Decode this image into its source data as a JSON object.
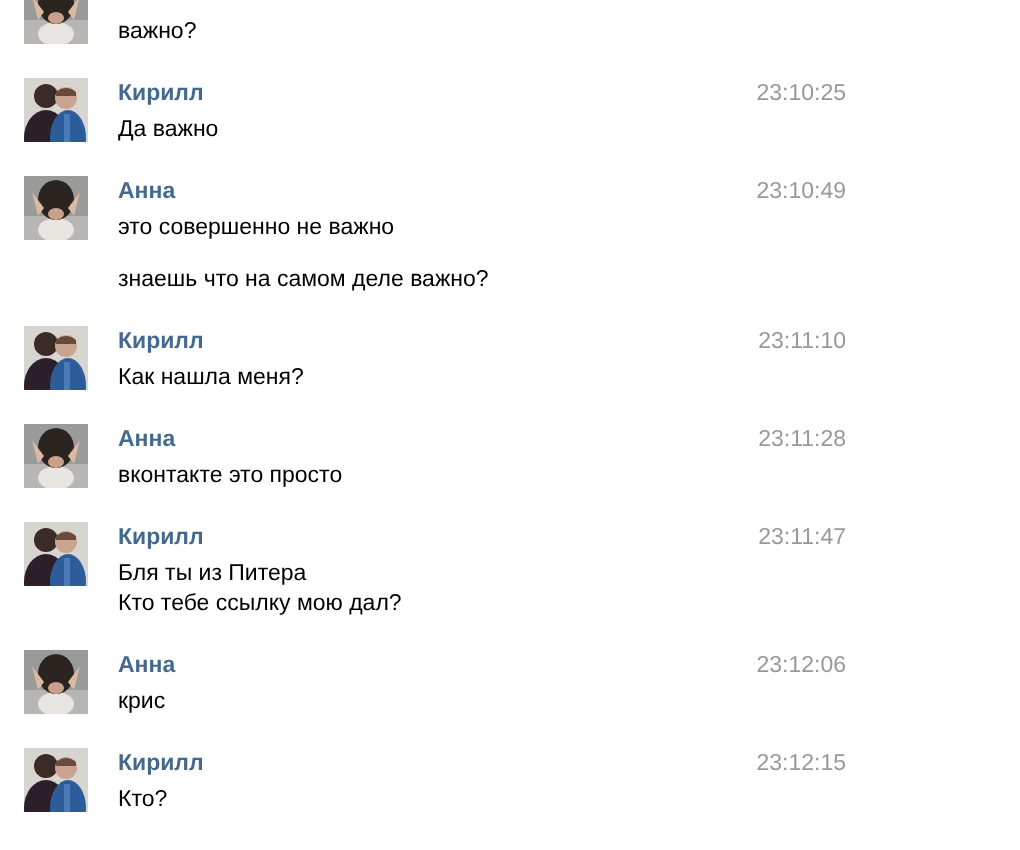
{
  "messages": [
    {
      "kind": "anna",
      "paragraphs": [
        "важно?"
      ]
    },
    {
      "kind": "kirill",
      "author": "Кирилл",
      "time": "23:10:25",
      "paragraphs": [
        "Да важно"
      ]
    },
    {
      "kind": "anna",
      "author": "Анна",
      "time": "23:10:49",
      "paragraphs": [
        "это совершенно не важно",
        "знаешь что на самом деле важно?"
      ]
    },
    {
      "kind": "kirill",
      "author": "Кирилл",
      "time": "23:11:10",
      "paragraphs": [
        "Как нашла меня?"
      ]
    },
    {
      "kind": "anna",
      "author": "Анна",
      "time": "23:11:28",
      "paragraphs": [
        "вконтакте это просто"
      ]
    },
    {
      "kind": "kirill",
      "author": "Кирилл",
      "time": "23:11:47",
      "paragraphs": [
        "Бля ты из Питера\nКто тебе ссылку мою дал?"
      ]
    },
    {
      "kind": "anna",
      "author": "Анна",
      "time": "23:12:06",
      "paragraphs": [
        "крис"
      ]
    },
    {
      "kind": "kirill",
      "author": "Кирилл",
      "time": "23:12:15",
      "paragraphs": [
        "Кто?"
      ]
    }
  ]
}
